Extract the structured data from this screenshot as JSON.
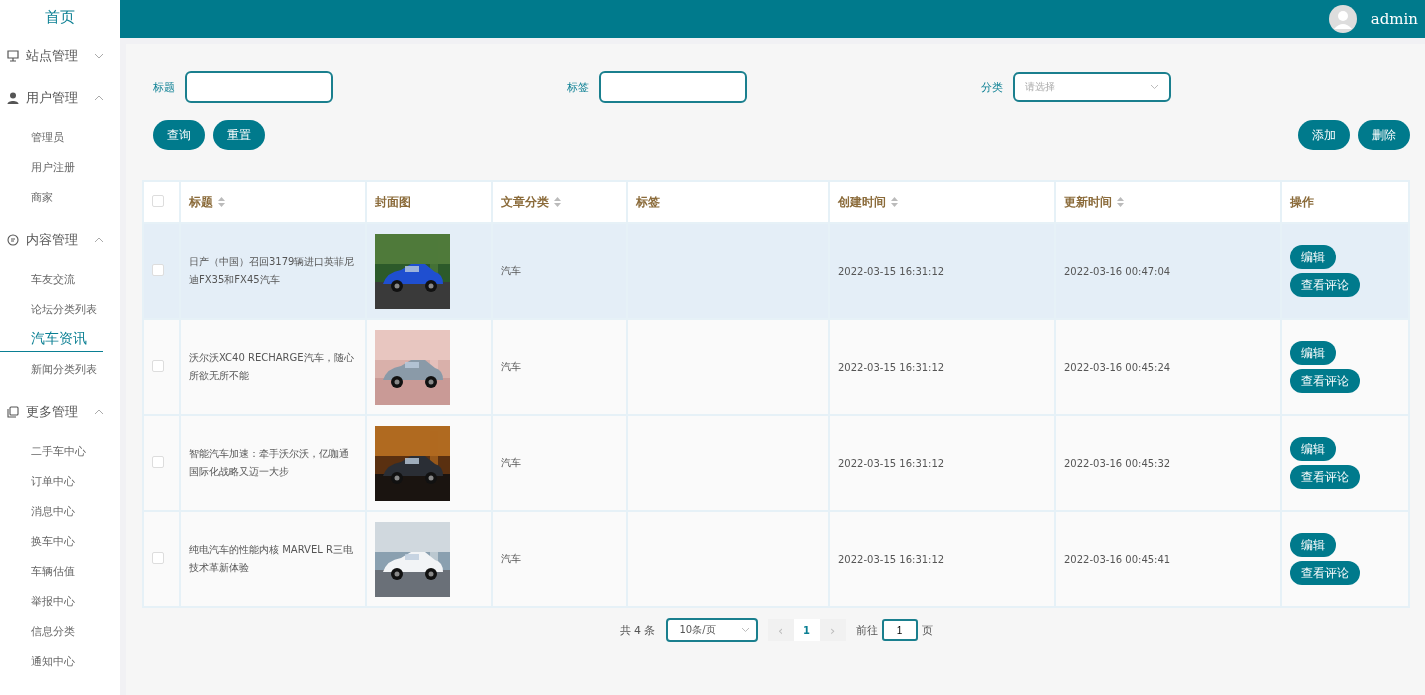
{
  "sidebar": {
    "home": "首页",
    "groups": [
      {
        "label": "站点管理",
        "expanded": false
      },
      {
        "label": "用户管理",
        "expanded": true,
        "items": [
          {
            "label": "管理员",
            "selected": false
          },
          {
            "label": "用户注册",
            "selected": false
          },
          {
            "label": "商家",
            "selected": false
          }
        ]
      },
      {
        "label": "内容管理",
        "expanded": true,
        "items": [
          {
            "label": "车友交流",
            "selected": false
          },
          {
            "label": "论坛分类列表",
            "selected": false
          },
          {
            "label": "汽车资讯",
            "selected": true
          },
          {
            "label": "新闻分类列表",
            "selected": false
          }
        ]
      },
      {
        "label": "更多管理",
        "expanded": true,
        "items": [
          {
            "label": "二手车中心",
            "selected": false
          },
          {
            "label": "订单中心",
            "selected": false
          },
          {
            "label": "消息中心",
            "selected": false
          },
          {
            "label": "换车中心",
            "selected": false
          },
          {
            "label": "车辆估值",
            "selected": false
          },
          {
            "label": "举报中心",
            "selected": false
          },
          {
            "label": "信息分类",
            "selected": false
          },
          {
            "label": "通知中心",
            "selected": false
          }
        ]
      }
    ]
  },
  "topbar": {
    "user": "admin"
  },
  "filters": [
    {
      "label": "标题",
      "kind": "text"
    },
    {
      "label": "标签",
      "kind": "text"
    },
    {
      "label": "分类",
      "kind": "select",
      "placeholder": "请选择"
    }
  ],
  "left_buttons": [
    "查询",
    "重置"
  ],
  "right_buttons": [
    "添加",
    "删除"
  ],
  "table": {
    "select_all_checked": false,
    "columns": [
      {
        "label": "标题",
        "sortable": true
      },
      {
        "label": "封面图",
        "sortable": false
      },
      {
        "label": "文章分类",
        "sortable": true
      },
      {
        "label": "标签",
        "sortable": false
      },
      {
        "label": "创建时间",
        "sortable": true
      },
      {
        "label": "更新时间",
        "sortable": true
      },
      {
        "label": "操作",
        "sortable": false
      }
    ],
    "rows": [
      {
        "checked": false,
        "hovered": true,
        "title": "日产（中国）召回3179辆进口英菲尼迪FX35和FX45汽车",
        "cover": {
          "kind": "picture"
        },
        "category": "汽车",
        "created": "2022-03-15 16:31:12",
        "updated": "2022-03-16 00:47:04",
        "actions": [
          "编辑",
          "查看评论"
        ]
      },
      {
        "checked": false,
        "hovered": false,
        "title": "沃尔沃XC40 RECHARGE汽车，随心所欲无所不能",
        "cover": {
          "kind": "picture"
        },
        "category": "汽车",
        "created": "2022-03-15 16:31:12",
        "updated": "2022-03-16 00:45:24",
        "actions": [
          "编辑",
          "查看评论"
        ]
      },
      {
        "checked": false,
        "hovered": false,
        "title": "智能汽车加速：牵手沃尔沃，亿咖通国际化战略又迈一大步",
        "cover": {
          "kind": "picture"
        },
        "category": "汽车",
        "created": "2022-03-15 16:31:12",
        "updated": "2022-03-16 00:45:32",
        "actions": [
          "编辑",
          "查看评论"
        ]
      },
      {
        "checked": false,
        "hovered": false,
        "title": "纯电汽车的性能内核 MARVEL R三电技术革新体验",
        "cover": {
          "kind": "picture"
        },
        "category": "汽车",
        "created": "2022-03-15 16:31:12",
        "updated": "2022-03-16 00:45:41",
        "actions": [
          "编辑",
          "查看评论"
        ]
      }
    ]
  },
  "pagination": {
    "total": "共 4 条",
    "page_size": "10条/页",
    "prev": "‹",
    "pages": [
      {
        "label": "1",
        "selected": true
      }
    ],
    "next": "›",
    "goto_label": "前往",
    "goto_value": "1",
    "goto_suffix": "页"
  }
}
